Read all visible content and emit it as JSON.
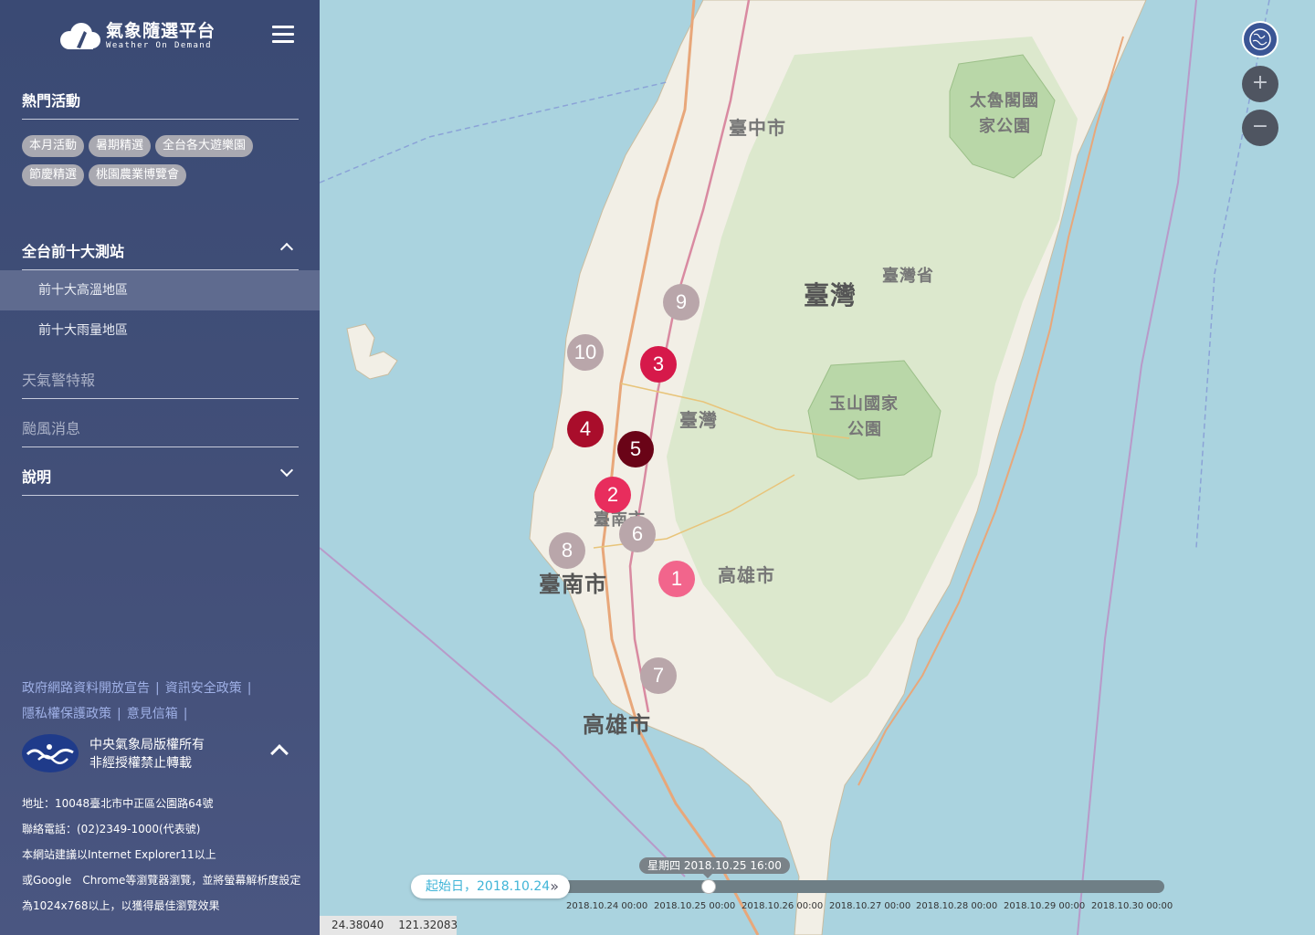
{
  "logo": {
    "title": "氣象隨選平台",
    "subtitle": "Weather On Demand"
  },
  "hot": {
    "title": "熱門活動",
    "tags": [
      "本月活動",
      "暑期精選",
      "全台各大遊樂園",
      "節慶精選",
      "桃園農業博覽會"
    ]
  },
  "stations": {
    "title": "全台前十大測站",
    "items": [
      "前十大高溫地區",
      "前十大雨量地區"
    ]
  },
  "menu": {
    "warning": "天氣警特報",
    "typhoon": "颱風消息",
    "help": "說明"
  },
  "footer": {
    "links": [
      "政府網路資料開放宣告",
      "資訊安全政策",
      "隱私權保護政策",
      "意見信箱"
    ],
    "copyright1": "中央氣象局版權所有",
    "copyright2": "非經授權禁止轉載",
    "address": "地址：10048臺北市中正區公園路64號",
    "phone": "聯絡電話：(02)2349-1000(代表號)",
    "browser1": "本網站建議以Internet Explorer11以上",
    "browser2": "或Google　Chrome等瀏覽器瀏覽，並將螢幕解析度設定",
    "browser3": "為1024x768以上，以獲得最佳瀏覽效果"
  },
  "map": {
    "labels": {
      "taichung": "臺中市",
      "taroko1": "太魯閣國",
      "taroko2": "家公園",
      "taiwan_big": "臺灣",
      "province": "臺灣省",
      "taiwan_mid": "臺灣",
      "yushan1": "玉山國家",
      "yushan2": "公園",
      "tainan": "臺南市",
      "tainan_small": "臺南市",
      "kaohsiung_n": "高雄市",
      "kaohsiung": "高雄市"
    },
    "markers": [
      {
        "rank": "1",
        "color": "#f2658c"
      },
      {
        "rank": "2",
        "color": "#e82d5d"
      },
      {
        "rank": "3",
        "color": "#d6194a"
      },
      {
        "rank": "4",
        "color": "#a90d2b"
      },
      {
        "rank": "5",
        "color": "#6a0417"
      },
      {
        "rank": "6",
        "color": "#b9a6aa"
      },
      {
        "rank": "7",
        "color": "#b9a6aa"
      },
      {
        "rank": "8",
        "color": "#b9a6aa"
      },
      {
        "rank": "9",
        "color": "#b9a6aa"
      },
      {
        "rank": "10",
        "color": "#b9a6aa"
      }
    ],
    "controls": {
      "zoom_in": "+",
      "zoom_out": "−"
    }
  },
  "timeline": {
    "start_label": "起始日，2018.10.24",
    "current": "星期四 2018.10.25 16:00",
    "ticks": [
      "2018.10.24 00:00",
      "2018.10.25 00:00",
      "2018.10.26 00:00",
      "2018.10.27 00:00",
      "2018.10.28 00:00",
      "2018.10.29 00:00",
      "2018.10.30 00:00"
    ]
  },
  "coords": {
    "lat": "24.38040",
    "lng": "121.32083"
  }
}
